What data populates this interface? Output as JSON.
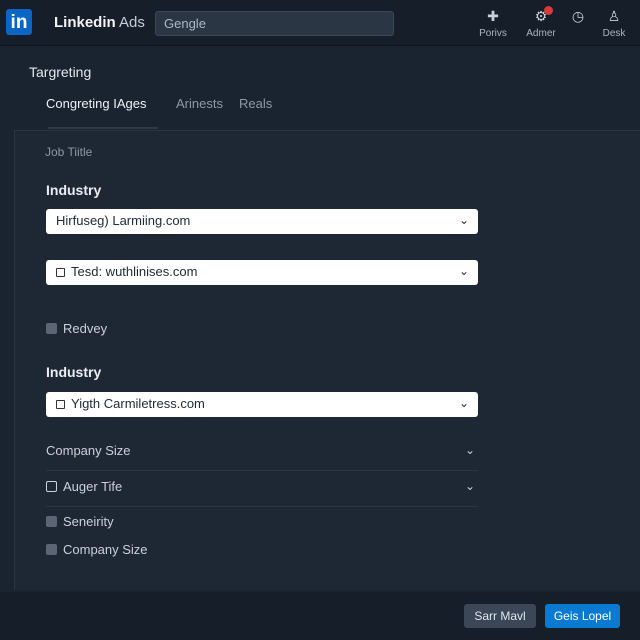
{
  "header": {
    "logo_text": "in",
    "brand_bold": "Linkedin",
    "brand_suffix": "Ads",
    "search_placeholder": "Gengle",
    "nav": [
      {
        "icon": "✚",
        "label": "Porivs",
        "name": "nav-porivs"
      },
      {
        "icon": "⚙",
        "label": "Admer",
        "name": "nav-admer"
      },
      {
        "icon": "◷",
        "label": "",
        "name": "nav-clock"
      },
      {
        "icon": "♙",
        "label": "Desk",
        "name": "nav-desk"
      }
    ],
    "badge_color": "#d63a3a"
  },
  "page_title": "Targreting",
  "tabs": [
    {
      "label": "Congreting IAges",
      "active": true
    },
    {
      "label": "Arinests",
      "active": false
    },
    {
      "label": "Reals",
      "active": false
    }
  ],
  "form": {
    "job_title_label": "Job Tiitle",
    "industry_1": {
      "title": "Industry",
      "select_1": "Hirfuseg) Larmiing.com",
      "select_2": "Tesd: wuthlinises.com",
      "checkbox": "Redvey"
    },
    "industry_2": {
      "title": "Industry",
      "select": "Yigth Carmiletress.com"
    },
    "company_size_row": "Company Size",
    "auger_tife_row": "Auger Tife",
    "checkbox_seneirity": "Seneirity",
    "checkbox_company_size": "Company Size"
  },
  "footer": {
    "secondary_label": "Sarr Mavl",
    "primary_label": "Geis Lopel"
  },
  "colors": {
    "accent": "#0a66c2",
    "primary_button": "#0a7ad1",
    "background": "#1a2330"
  }
}
